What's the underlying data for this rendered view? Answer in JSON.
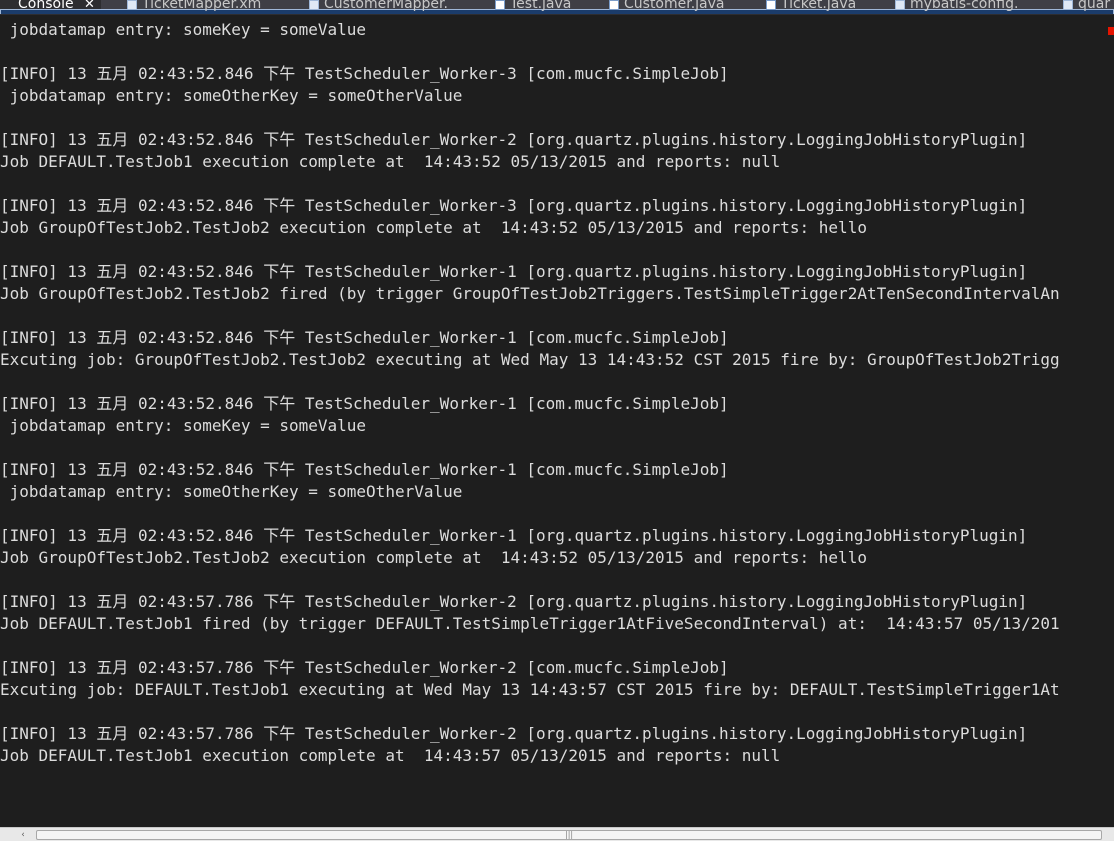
{
  "tabs": [
    {
      "label": "Console",
      "active": true,
      "icon": "console-icon"
    },
    {
      "label": "TicketMapper.xm",
      "active": false,
      "icon": "xml-file-icon"
    },
    {
      "label": "CustomerMapper.",
      "active": false,
      "icon": "xml-file-icon"
    },
    {
      "label": "Test.java",
      "active": false,
      "icon": "java-file-icon"
    },
    {
      "label": "Customer.java",
      "active": false,
      "icon": "java-file-icon"
    },
    {
      "label": "Ticket.java",
      "active": false,
      "icon": "java-file-icon"
    },
    {
      "label": "mybatis-config.",
      "active": false,
      "icon": "xml-file-icon"
    },
    {
      "label": "quar",
      "active": false,
      "icon": "xml-file-icon"
    }
  ],
  "console": {
    "lines": [
      " jobdatamap entry: someKey = someValue",
      "",
      "[INFO] 13 五月 02:43:52.846 下午 TestScheduler_Worker-3 [com.mucfc.SimpleJob]",
      " jobdatamap entry: someOtherKey = someOtherValue",
      "",
      "[INFO] 13 五月 02:43:52.846 下午 TestScheduler_Worker-2 [org.quartz.plugins.history.LoggingJobHistoryPlugin]",
      "Job DEFAULT.TestJob1 execution complete at  14:43:52 05/13/2015 and reports: null",
      "",
      "[INFO] 13 五月 02:43:52.846 下午 TestScheduler_Worker-3 [org.quartz.plugins.history.LoggingJobHistoryPlugin]",
      "Job GroupOfTestJob2.TestJob2 execution complete at  14:43:52 05/13/2015 and reports: hello",
      "",
      "[INFO] 13 五月 02:43:52.846 下午 TestScheduler_Worker-1 [org.quartz.plugins.history.LoggingJobHistoryPlugin]",
      "Job GroupOfTestJob2.TestJob2 fired (by trigger GroupOfTestJob2Triggers.TestSimpleTrigger2AtTenSecondIntervalAn",
      "",
      "[INFO] 13 五月 02:43:52.846 下午 TestScheduler_Worker-1 [com.mucfc.SimpleJob]",
      "Excuting job: GroupOfTestJob2.TestJob2 executing at Wed May 13 14:43:52 CST 2015 fire by: GroupOfTestJob2Trigg",
      "",
      "[INFO] 13 五月 02:43:52.846 下午 TestScheduler_Worker-1 [com.mucfc.SimpleJob]",
      " jobdatamap entry: someKey = someValue",
      "",
      "[INFO] 13 五月 02:43:52.846 下午 TestScheduler_Worker-1 [com.mucfc.SimpleJob]",
      " jobdatamap entry: someOtherKey = someOtherValue",
      "",
      "[INFO] 13 五月 02:43:52.846 下午 TestScheduler_Worker-1 [org.quartz.plugins.history.LoggingJobHistoryPlugin]",
      "Job GroupOfTestJob2.TestJob2 execution complete at  14:43:52 05/13/2015 and reports: hello",
      "",
      "[INFO] 13 五月 02:43:57.786 下午 TestScheduler_Worker-2 [org.quartz.plugins.history.LoggingJobHistoryPlugin]",
      "Job DEFAULT.TestJob1 fired (by trigger DEFAULT.TestSimpleTrigger1AtFiveSecondInterval) at:  14:43:57 05/13/201",
      "",
      "[INFO] 13 五月 02:43:57.786 下午 TestScheduler_Worker-2 [com.mucfc.SimpleJob]",
      "Excuting job: DEFAULT.TestJob1 executing at Wed May 13 14:43:57 CST 2015 fire by: DEFAULT.TestSimpleTrigger1At",
      "",
      "[INFO] 13 五月 02:43:57.786 下午 TestScheduler_Worker-2 [org.quartz.plugins.history.LoggingJobHistoryPlugin]",
      "Job DEFAULT.TestJob1 execution complete at  14:43:57 05/13/2015 and reports: null"
    ]
  },
  "scrollbar": {
    "left_arrow": "‹",
    "grip": "|||"
  },
  "colors": {
    "background": "#1e1e1e",
    "text": "#dcdcdc",
    "tab_bar": "#3f3f46",
    "error_marker": "#e51400"
  }
}
